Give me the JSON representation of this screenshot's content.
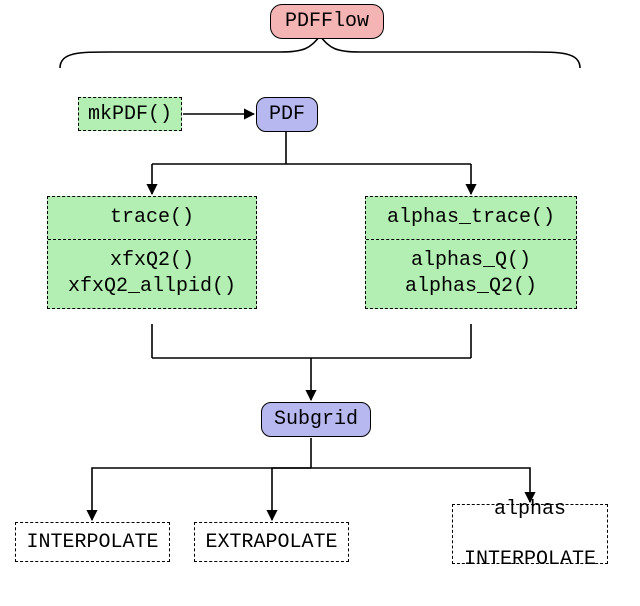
{
  "title": "PDFFlow",
  "mkpdf": "mkPDF()",
  "pdf": "PDF",
  "left_group": {
    "top": "trace()",
    "bottom1": "xfxQ2()",
    "bottom2": "xfxQ2_allpid()"
  },
  "right_group": {
    "top": "alphas_trace()",
    "bottom1": "alphas_Q()",
    "bottom2": "alphas_Q2()"
  },
  "subgrid": "Subgrid",
  "interpolate": "INTERPOLATE",
  "extrapolate": "EXTRAPOLATE",
  "alphas_interp1": "alphas",
  "alphas_interp2": "INTERPOLATE"
}
